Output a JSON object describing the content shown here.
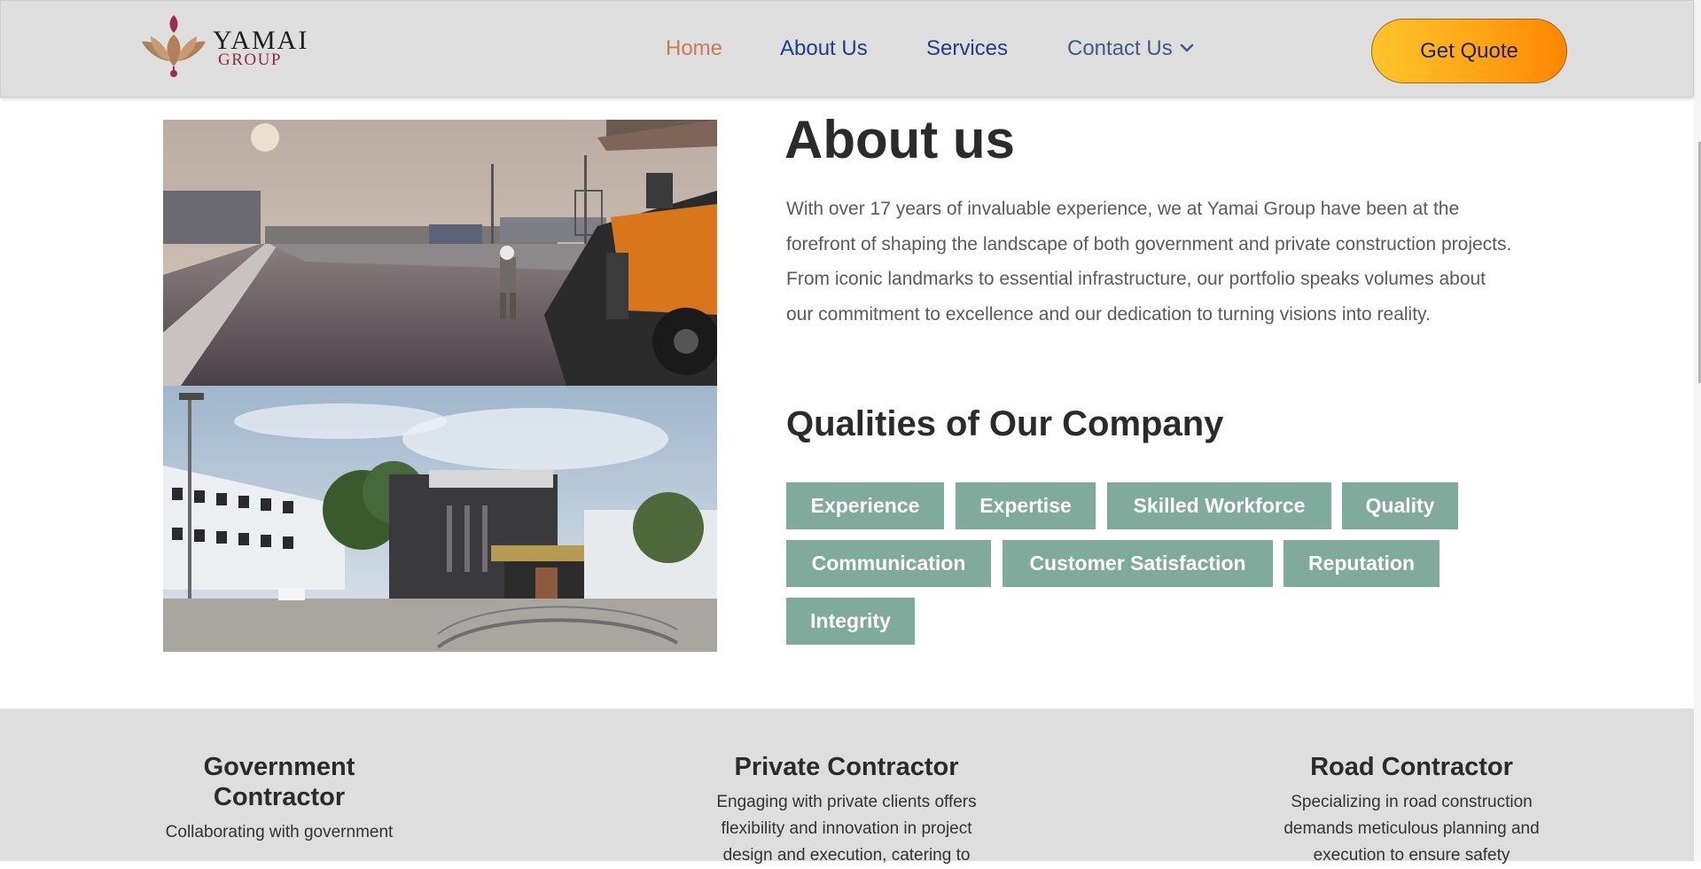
{
  "header": {
    "logo": {
      "name": "YAMAI",
      "sub": "GROUP"
    },
    "nav": [
      {
        "label": "Home",
        "active": true
      },
      {
        "label": "About Us"
      },
      {
        "label": "Services"
      },
      {
        "label": "Contact Us",
        "has_dropdown": true
      }
    ],
    "cta_label": "Get Quote"
  },
  "about": {
    "title": "About us",
    "paragraph": "With over 17 years of invaluable experience, we at Yamai Group have been at the forefront of shaping the landscape of both government and private construction projects. From iconic landmarks to essential infrastructure, our portfolio speaks volumes about our commitment to excellence and our dedication to turning visions into reality."
  },
  "qualities": {
    "title": "Qualities of Our Company",
    "tags": [
      "Experience",
      "Expertise",
      "Skilled Workforce",
      "Quality",
      "Communication",
      "Customer Satisfaction",
      "Reputation",
      "Integrity"
    ]
  },
  "services": [
    {
      "title": "Government Contractor",
      "text": "Collaborating with government"
    },
    {
      "title": "Private Contractor",
      "text": "Engaging with private clients offers flexibility and innovation in project design and execution, catering to"
    },
    {
      "title": "Road Contractor",
      "text": "Specializing in road construction demands meticulous planning and execution to ensure safety"
    }
  ],
  "colors": {
    "header_bg": "#dedede",
    "nav_active": "#cc7a55",
    "nav_link": "#1d3f8a",
    "tag_bg": "#80aa9b",
    "cta_gradient": [
      "#ffc52a",
      "#ff8500"
    ]
  }
}
